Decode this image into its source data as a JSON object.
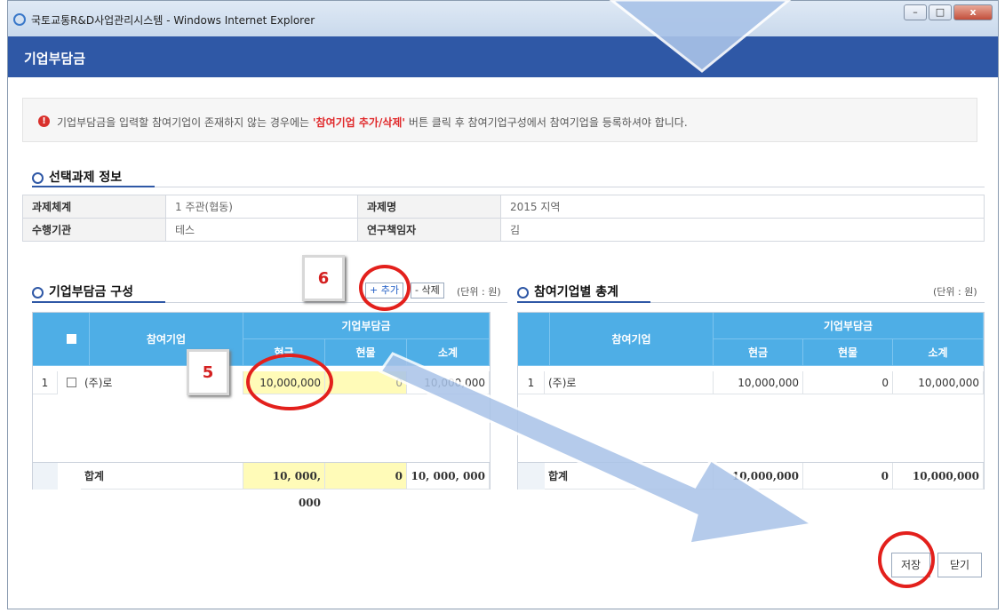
{
  "window": {
    "title": "국토교통R&D사업관리시스템 - Windows Internet Explorer",
    "min": "–",
    "max": "□",
    "close": "x"
  },
  "app": {
    "title": "기업부담금"
  },
  "notice": {
    "before": "기업부담금을 입력할 참여기업이 존재하지 않는 경우에는 ",
    "highlight": "'참여기업 추가/삭제'",
    "after": " 버튼 클릭 후 참여기업구성에서 참여기업을 등록하셔야 합니다."
  },
  "task_info": {
    "title": "선택과제 정보",
    "rows": [
      {
        "label1": "과제체계",
        "value1": "1 주관(협동)",
        "label2": "과제명",
        "value2": "2015 지역"
      },
      {
        "label1": "수행기관",
        "value1": "테스",
        "label2": "연구책임자",
        "value2": "김"
      }
    ]
  },
  "contrib": {
    "title": "기업부담금 구성",
    "add_label": "+ 추가",
    "delete_label": "- 삭제",
    "unit": "(단위 : 원)",
    "headers": {
      "company": "참여기업",
      "group": "기업부담금",
      "cash": "현금",
      "inkind": "현물",
      "subtotal": "소계"
    },
    "rows": [
      {
        "no": "1",
        "company": "(주)로",
        "cash": "10,000,000",
        "inkind": "0",
        "subtotal": "10,000,000"
      }
    ],
    "total": {
      "label": "합계",
      "cash": "10, 000, 000",
      "inkind": "0",
      "subtotal": "10, 000, 000"
    }
  },
  "totals": {
    "title": "참여기업별 총계",
    "unit": "(단위 : 원)",
    "headers": {
      "company": "참여기업",
      "group": "기업부담금",
      "cash": "현금",
      "inkind": "현물",
      "subtotal": "소계"
    },
    "rows": [
      {
        "no": "1",
        "company": "(주)로",
        "cash": "10,000,000",
        "inkind": "0",
        "subtotal": "10,000,000"
      }
    ],
    "total": {
      "label": "합계",
      "cash": "10,000,000",
      "inkind": "0",
      "subtotal": "10,000,000"
    }
  },
  "actions": {
    "save": "저장",
    "close": "닫기"
  },
  "annotations": {
    "step5": "5",
    "step6": "6"
  },
  "colors": {
    "header_blue": "#4eaee6",
    "app_bar": "#2f58a6",
    "highlight_red": "#e0282a",
    "input_yellow": "#fffbb8"
  }
}
